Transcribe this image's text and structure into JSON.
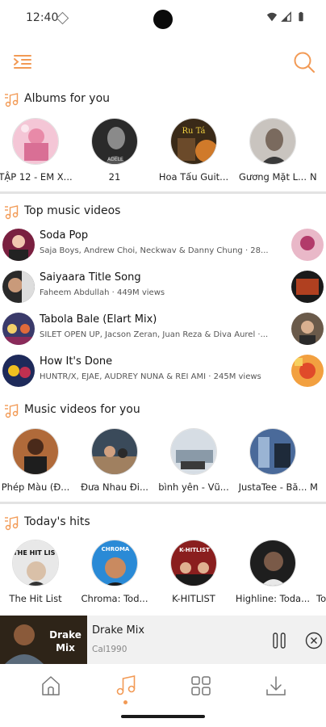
{
  "status_bar": {
    "time": "12:40"
  },
  "colors": {
    "accent": "#f29a55",
    "divider": "#e3e3e3",
    "mini_player_bg": "#f1f1f1"
  },
  "sections": {
    "albums": {
      "title": "Albums for you",
      "items": [
        {
          "name": "TẬP 12 - EM X..."
        },
        {
          "name": "21"
        },
        {
          "name": "Hoa Tấu Guit..."
        },
        {
          "name": "Gương Mặt L..."
        },
        {
          "name": "N"
        }
      ]
    },
    "top_videos": {
      "title": "Top music videos",
      "items": [
        {
          "title": "Soda Pop",
          "meta": "Saja Boys, Andrew Choi, Neckwav & Danny Chung · 28..."
        },
        {
          "title": "Saiyaara Title Song",
          "meta": "Faheem Abdullah · 449M views"
        },
        {
          "title": "Tabola Bale (Elart Mix)",
          "meta": "SILET OPEN UP, Jacson Zeran, Juan Reza & Diva Aurel ·..."
        },
        {
          "title": "How It's Done",
          "meta": "HUNTR/X, EJAE, AUDREY NUNA & REI AMI · 245M views"
        }
      ]
    },
    "videos_for_you": {
      "title": "Music videos for you",
      "items": [
        {
          "name": "Phép Màu (Đ..."
        },
        {
          "name": "Đưa Nhau Đi..."
        },
        {
          "name": "bình yên - Vũ..."
        },
        {
          "name": "JustaTee - Bă..."
        },
        {
          "name": "M"
        }
      ]
    },
    "todays_hits": {
      "title": "Today's hits",
      "items": [
        {
          "name": "The Hit List"
        },
        {
          "name": "Chroma: Tod..."
        },
        {
          "name": "K-HITLIST"
        },
        {
          "name": "Highline: Toda..."
        },
        {
          "name": "To"
        }
      ]
    }
  },
  "mini_player": {
    "title": "Drake Mix",
    "artist": "Cal1990",
    "art_text_1": "Drake",
    "art_text_2": "Mix"
  },
  "art_labels": {
    "album_2": "ADELE",
    "album_3": "Ru Tá",
    "hit_1": "THE HIT LIST",
    "hit_2": "CHROMA",
    "hit_3": "K-HITLIST"
  },
  "bottom_nav": {
    "active": "music"
  }
}
